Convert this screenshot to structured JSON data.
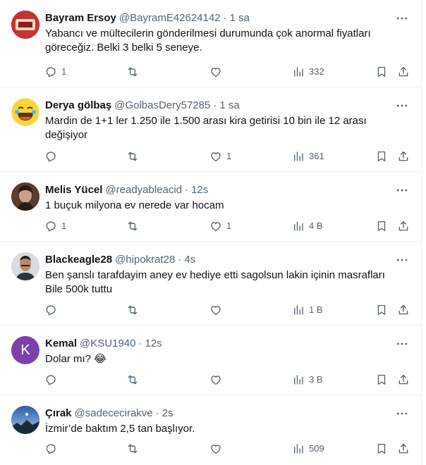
{
  "colors": {
    "text": "#0f1419",
    "secondary": "#536471",
    "divider": "#eff3f4",
    "kemal_avatar": "#7e3fae"
  },
  "tweets": [
    {
      "name": "Bayram Ersoy",
      "handle": "@BayramE42624142",
      "separator": "·",
      "time": "1 sa",
      "text": "Yabancı ve mültecilerin gönderilmesi durumunda çok anormal fiyatları göreceğiz. Belki 3 belki 5 seneye.",
      "replies": "1",
      "retweets": "",
      "likes": "",
      "views": "332",
      "icons": {
        "more": "more-icon",
        "reply": "reply-icon",
        "retweet": "retweet-icon",
        "like": "like-icon",
        "views": "views-icon",
        "bookmark": "bookmark-icon",
        "share": "share-icon"
      }
    },
    {
      "name": "Derya gölbaş",
      "handle": "@GolbasDery57285",
      "separator": "·",
      "time": "1 sa",
      "text": "Mardin de 1+1 ler 1.250 ile 1.500 arası kira getirisi 10 bin ile 12 arası değişiyor",
      "replies": "",
      "retweets": "",
      "likes": "1",
      "views": "361"
    },
    {
      "name": "Melis Yücel",
      "handle": "@readyableacid",
      "separator": "·",
      "time": "12s",
      "text": "1 buçuk milyona ev nerede var hocam",
      "replies": "1",
      "retweets": "",
      "likes": "1",
      "views": "4 B"
    },
    {
      "name": "Blackeagle28",
      "handle": "@hipokrat28",
      "separator": "·",
      "time": "4s",
      "text": "Ben şanslı tarafdayim aney ev hediye etti sagolsun lakin içinin masrafları Bile 500k tuttu",
      "replies": "",
      "retweets": "",
      "likes": "",
      "views": "1 B"
    },
    {
      "name": "Kemal",
      "handle": "@KSU1940",
      "separator": "·",
      "time": "12s",
      "text": "Dolar mı? 😂",
      "avatar_letter": "K",
      "replies": "",
      "retweets": "",
      "likes": "",
      "views": "3 B"
    },
    {
      "name": "Çırak",
      "handle": "@sadececirakve",
      "separator": "·",
      "time": "2s",
      "text": "İzmir’de baktım 2,5 tan başlıyor.",
      "replies": "",
      "retweets": "",
      "likes": "",
      "views": "509"
    }
  ]
}
